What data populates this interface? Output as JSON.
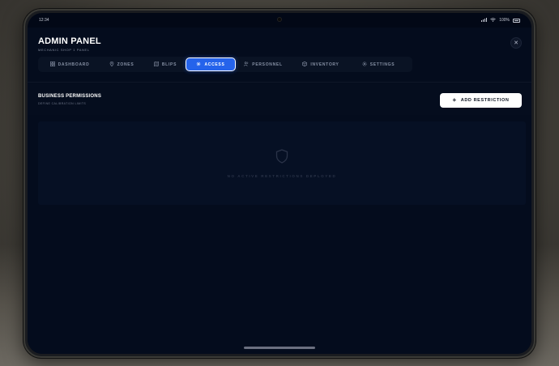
{
  "statusbar": {
    "time": "12:34",
    "battery": "100%",
    "icons": [
      "signal-icon",
      "wifi-icon",
      "battery-icon"
    ]
  },
  "header": {
    "title": "ADMIN PANEL",
    "subtitle": "MECHANIC SHOP 1 PANEL"
  },
  "tabs": [
    {
      "label": "DASHBOARD",
      "icon": "dashboard-icon",
      "active": false
    },
    {
      "label": "ZONES",
      "icon": "map-pin-icon",
      "active": false
    },
    {
      "label": "BLIPS",
      "icon": "map-icon",
      "active": false
    },
    {
      "label": "ACCESS",
      "icon": "gear-icon",
      "active": true
    },
    {
      "label": "PERSONNEL",
      "icon": "users-icon",
      "active": false
    },
    {
      "label": "INVENTORY",
      "icon": "box-icon",
      "active": false
    },
    {
      "label": "SETTINGS",
      "icon": "settings-icon",
      "active": false
    }
  ],
  "section": {
    "title": "BUSINESS PERMISSIONS",
    "subtitle": "DEFINE CALIBRATION LIMITS",
    "add_button": "ADD RESTRICTION"
  },
  "empty_state": {
    "icon": "shield-icon",
    "text": "NO ACTIVE RESTRICTIONS DEPLOYED"
  },
  "colors": {
    "accent": "#2563eb",
    "panel_bg": "#040c1d",
    "text_primary": "#ffffff",
    "text_muted": "#7f8798"
  }
}
